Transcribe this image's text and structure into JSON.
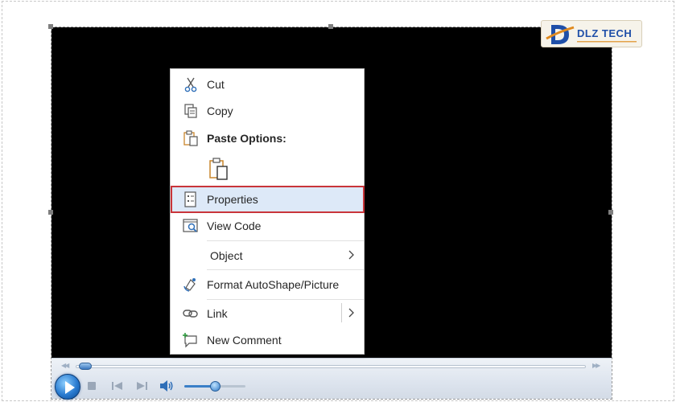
{
  "logo": {
    "text": "DLZ TECH"
  },
  "context_menu": {
    "items": [
      {
        "label": "Cut",
        "icon": "scissors-icon"
      },
      {
        "label": "Copy",
        "icon": "copy-icon"
      },
      {
        "label": "Paste Options:",
        "icon": "paste-icon"
      },
      {
        "label": "",
        "icon": "paste-keep-source-icon"
      },
      {
        "label": "Properties",
        "icon": "properties-icon"
      },
      {
        "label": "View Code",
        "icon": "view-code-icon"
      },
      {
        "label": "Object",
        "icon": "submenu-arrow-icon"
      },
      {
        "label": "Format AutoShape/Picture",
        "icon": "format-shape-icon"
      },
      {
        "label": "Link",
        "icon": "link-icon"
      },
      {
        "label": "New Comment",
        "icon": "new-comment-icon"
      }
    ],
    "highlighted_item": "Properties"
  },
  "player": {
    "seek_position": 0.01,
    "volume_level": 0.5
  },
  "colors": {
    "highlight_border": "#c9353a",
    "highlight_fill": "#dde9f8",
    "video_background": "#000000",
    "accent": "#2a7bd0"
  }
}
